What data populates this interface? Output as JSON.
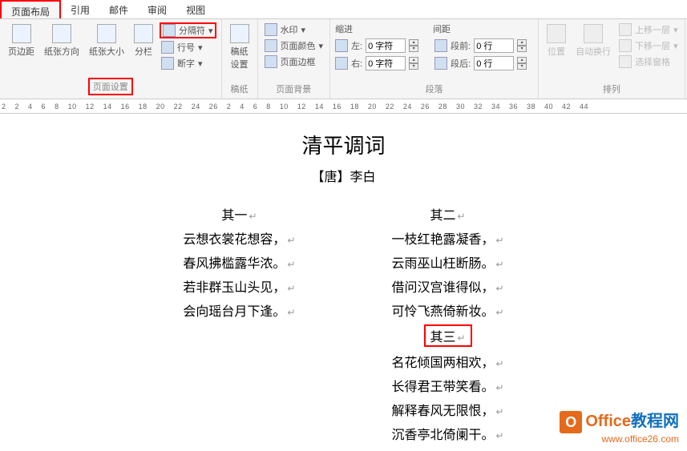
{
  "tabs": {
    "layout": "页面布局",
    "reference": "引用",
    "mail": "邮件",
    "review": "审阅",
    "view": "视图"
  },
  "ribbon": {
    "pageSetup": {
      "margins": "页边距",
      "orientation": "纸张方向",
      "size": "纸张大小",
      "columns": "分栏",
      "breaks": "分隔符",
      "lineNumbers": "行号",
      "hyphenation": "断字",
      "groupLabel": "页面设置"
    },
    "stationery": {
      "settings": "稿纸\n设置",
      "groupLabel": "稿纸"
    },
    "pageBackground": {
      "watermark": "水印",
      "pageColor": "页面颜色",
      "pageBorder": "页面边框",
      "groupLabel": "页面背景"
    },
    "paragraph": {
      "indentLabel": "缩进",
      "leftLabel": "左:",
      "rightLabel": "右:",
      "leftVal": "0 字符",
      "rightVal": "0 字符",
      "spacingLabel": "间距",
      "beforeLabel": "段前:",
      "afterLabel": "段后:",
      "beforeVal": "0 行",
      "afterVal": "0 行",
      "groupLabel": "段落"
    },
    "arrange": {
      "position": "位置",
      "wrap": "自动换行",
      "bringForward": "上移一层",
      "sendBackward": "下移一层",
      "selectionPane": "选择窗格",
      "groupLabel": "排列"
    }
  },
  "ruler": [
    "2",
    "2",
    "4",
    "6",
    "8",
    "10",
    "12",
    "14",
    "16",
    "18",
    "20",
    "22",
    "24",
    "26",
    "2",
    "4",
    "6",
    "8",
    "10",
    "12",
    "14",
    "16",
    "18",
    "20",
    "22",
    "24",
    "26",
    "28",
    "30",
    "32",
    "34",
    "36",
    "38",
    "40",
    "42",
    "44"
  ],
  "document": {
    "title": "清平调词",
    "subtitle": "【唐】李白",
    "col1": {
      "heading": "其一",
      "lines": [
        "云想衣裳花想容，",
        "春风拂槛露华浓。",
        "若非群玉山头见，",
        "会向瑶台月下逢。"
      ]
    },
    "col2": {
      "heading": "其二",
      "lines1": [
        "一枝红艳露凝香，",
        "云雨巫山枉断肠。",
        "借问汉宫谁得似，",
        "可怜飞燕倚新妆。"
      ],
      "heading2": "其三",
      "lines2": [
        "名花倾国两相欢，",
        "长得君王带笑看。",
        "解释春风无限恨，",
        "沉香亭北倚阑干。"
      ]
    }
  },
  "watermark": {
    "brand1": "Office",
    "brand2": "教程网",
    "url": "www.office26.com"
  }
}
